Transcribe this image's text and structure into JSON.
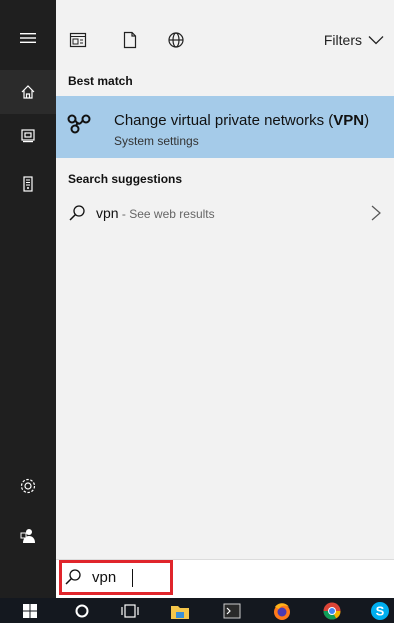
{
  "toolbar": {
    "filters_label": "Filters"
  },
  "sections": {
    "best_match": "Best match",
    "search_suggestions": "Search suggestions"
  },
  "best_match": {
    "title_prefix": "Change virtual private networks (",
    "title_bold": "VPN",
    "title_suffix": ")",
    "subtitle": "System settings"
  },
  "suggestion": {
    "query": "vpn",
    "hint": " - See web results"
  },
  "search": {
    "value": "vpn"
  },
  "rail_icons": [
    "menu-icon",
    "home-icon",
    "documents-icon",
    "device-icon",
    "settings-icon",
    "user-icon"
  ],
  "colors": {
    "rail_bg": "#1f1f1f",
    "highlight_bg": "#a5cbe9",
    "search_highlight_border": "#e0252b",
    "taskbar_bg": "#14181f"
  }
}
